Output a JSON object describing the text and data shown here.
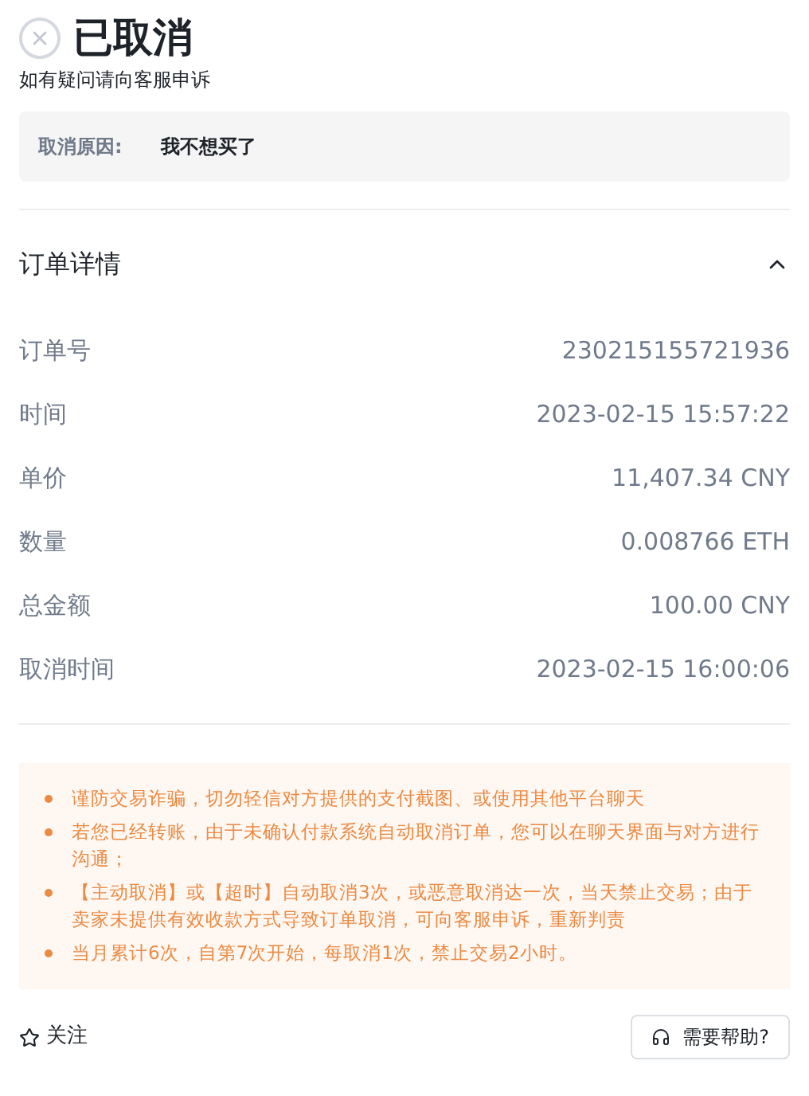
{
  "status": {
    "title": "已取消",
    "subtitle": "如有疑问请向客服申诉"
  },
  "reason": {
    "label": "取消原因:",
    "value": "我不想买了"
  },
  "details": {
    "title": "订单详情",
    "expanded": true,
    "rows": [
      {
        "label": "订单号",
        "value": "230215155721936"
      },
      {
        "label": "时间",
        "value": "2023-02-15 15:57:22"
      },
      {
        "label": "单价",
        "value": "11,407.34 CNY"
      },
      {
        "label": "数量",
        "value": "0.008766 ETH"
      },
      {
        "label": "总金额",
        "value": "100.00 CNY"
      },
      {
        "label": "取消时间",
        "value": "2023-02-15 16:00:06"
      }
    ]
  },
  "notices": [
    "谨防交易诈骗，切勿轻信对方提供的支付截图、或使用其他平台聊天",
    "若您已经转账，由于未确认付款系统自动取消订单，您可以在聊天界面与对方进行沟通；",
    "【主动取消】或【超时】自动取消3次，或恶意取消达一次，当天禁止交易；由于卖家未提供有效收款方式导致订单取消，可向客服申诉，重新判责",
    "当月累计6次，自第7次开始，每取消1次，禁止交易2小时。"
  ],
  "footer": {
    "follow": {
      "label": "关注",
      "followed": false
    },
    "help": "需要帮助?"
  }
}
